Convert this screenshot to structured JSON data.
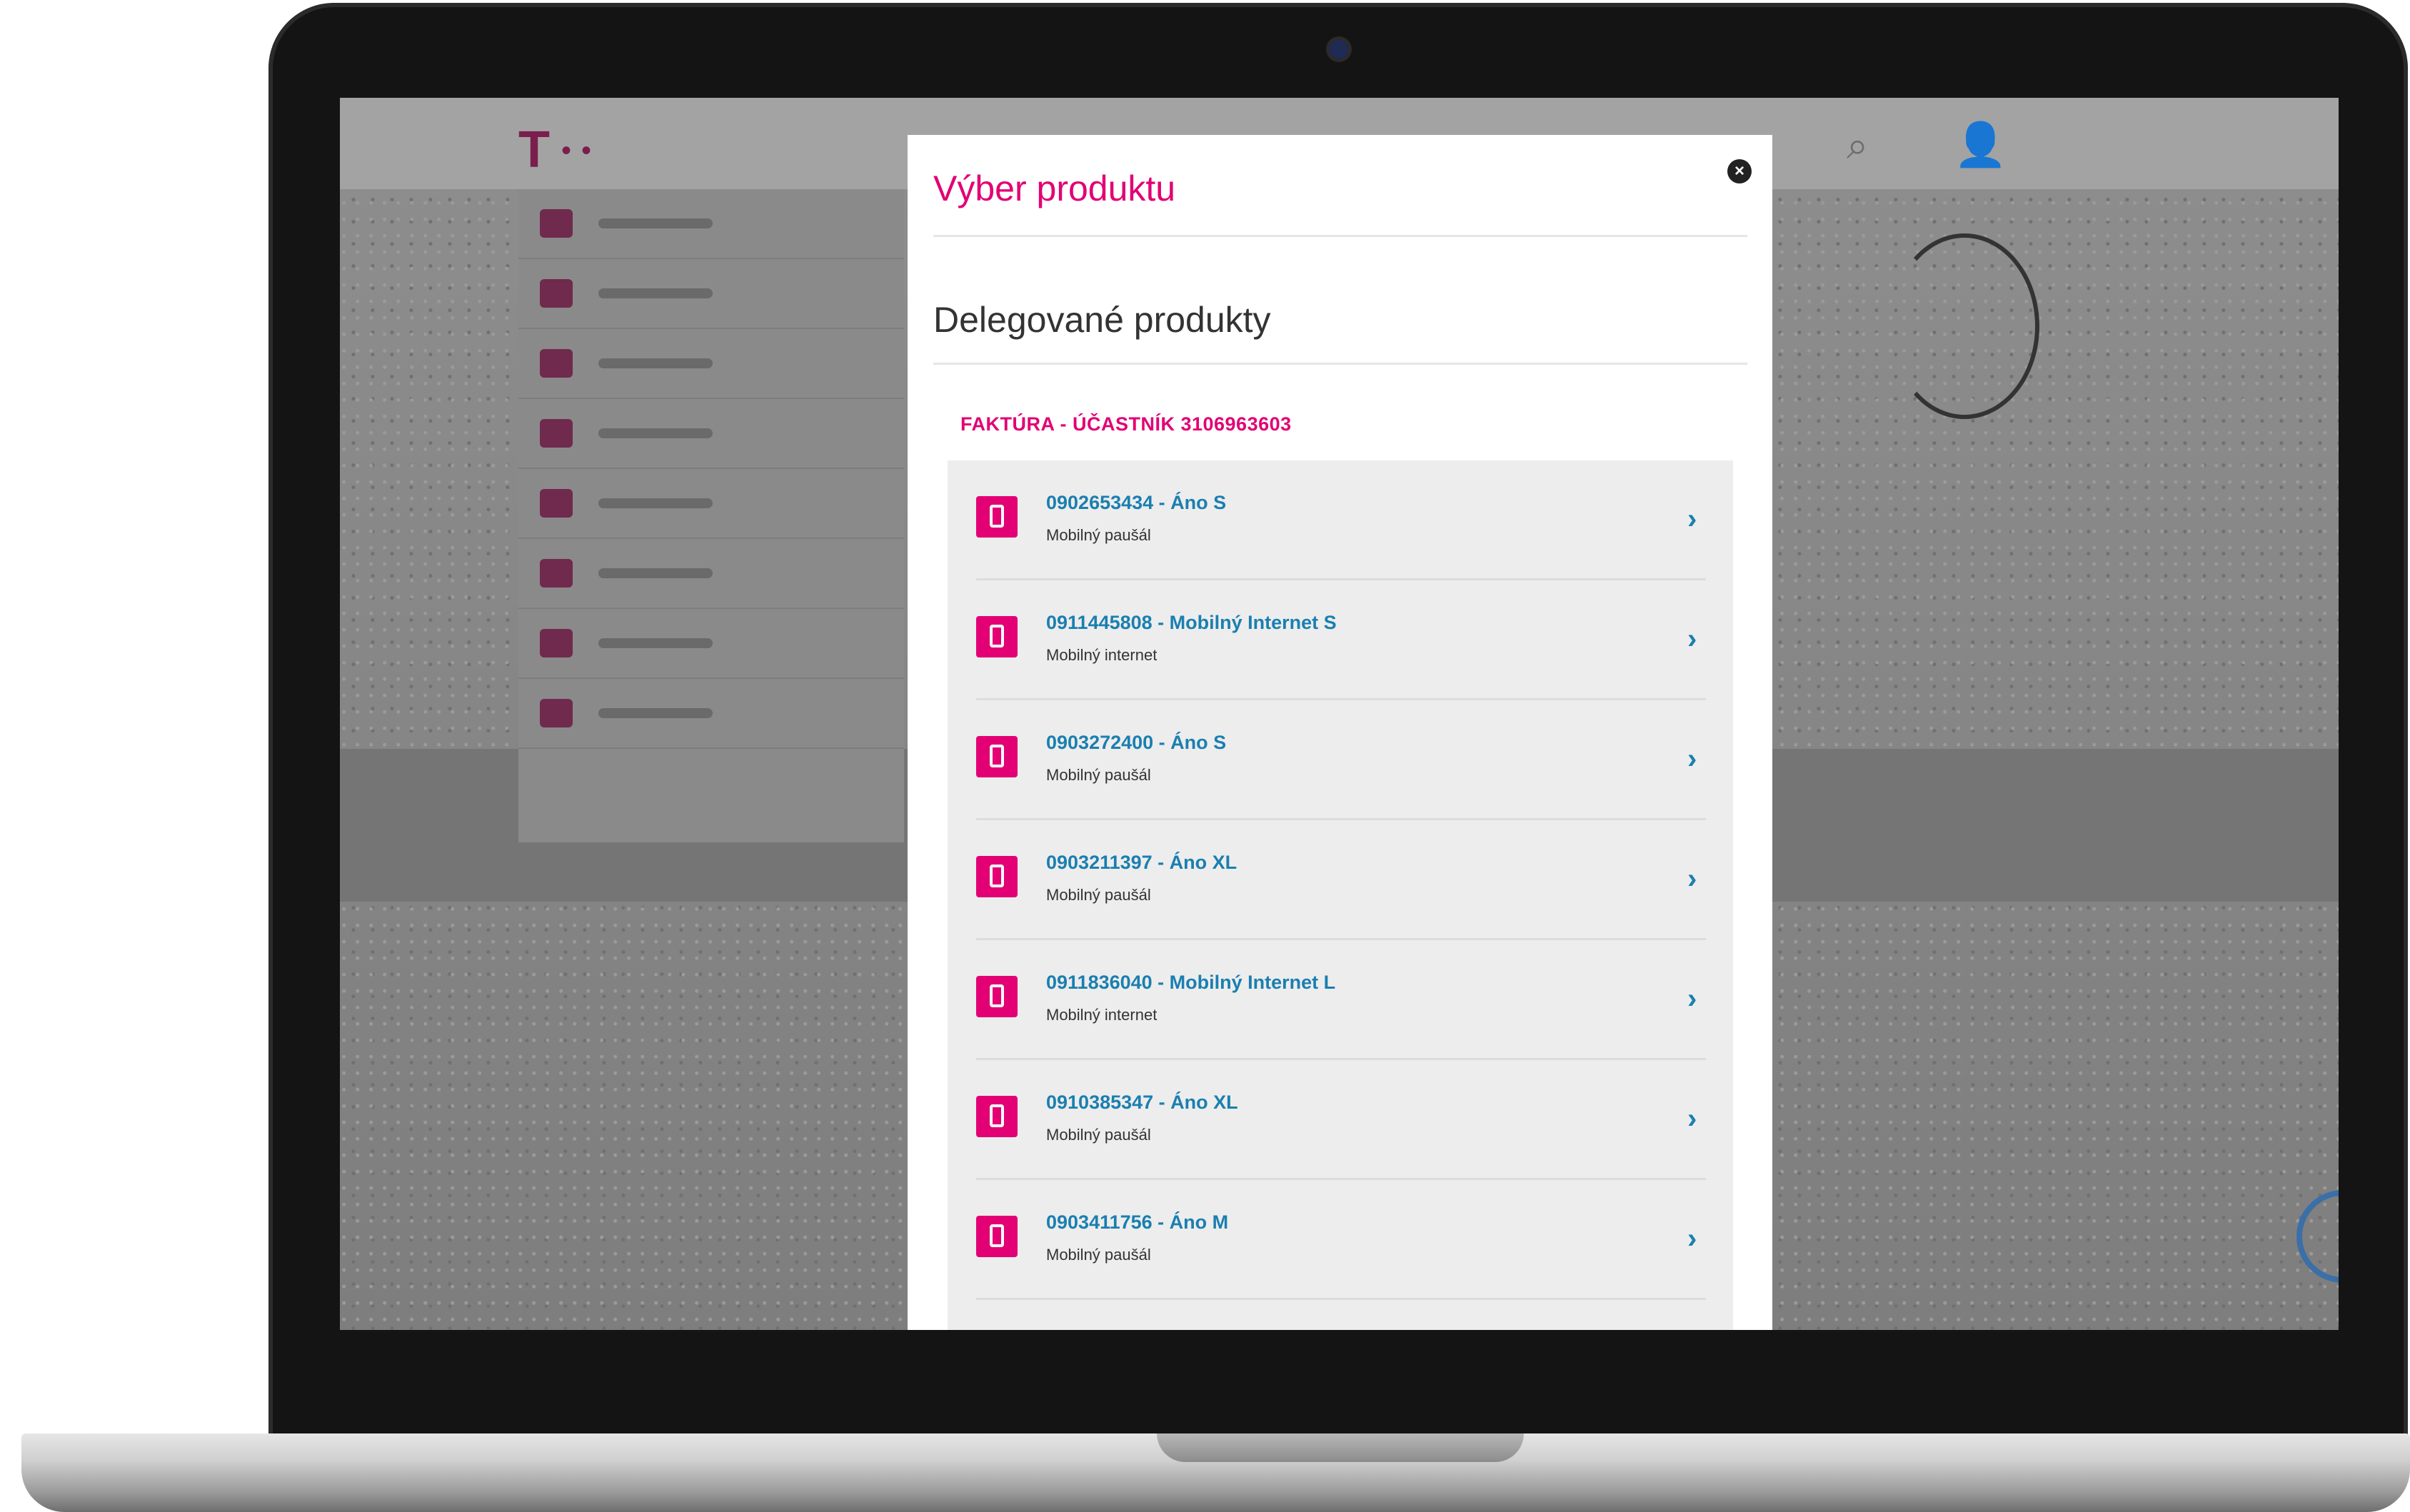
{
  "modal": {
    "title": "Výber produktu",
    "close_icon": "close-icon",
    "section_heading": "Delegované produkty",
    "group_label": "FAKTÚRA - ÚČASTNÍK 3106963603",
    "products": [
      {
        "name": "0902653434 - Áno S",
        "type": "Mobilný paušál",
        "icon": "phone-icon"
      },
      {
        "name": "0911445808 - Mobilný Internet S",
        "type": "Mobilný internet",
        "icon": "phone-icon"
      },
      {
        "name": "0903272400 - Áno S",
        "type": "Mobilný paušál",
        "icon": "phone-icon"
      },
      {
        "name": "0903211397 - Áno XL",
        "type": "Mobilný paušál",
        "icon": "phone-icon"
      },
      {
        "name": "0911836040 - Mobilný Internet L",
        "type": "Mobilný internet",
        "icon": "phone-icon"
      },
      {
        "name": "0910385347 - Áno XL",
        "type": "Mobilný paušál",
        "icon": "phone-icon"
      },
      {
        "name": "0903411756 - Áno M",
        "type": "Mobilný paušál",
        "icon": "phone-icon"
      }
    ]
  },
  "colors": {
    "brand_magenta": "#e20074",
    "link_blue": "#1a7fb0",
    "overlay_gray": "#8c8c8c"
  }
}
